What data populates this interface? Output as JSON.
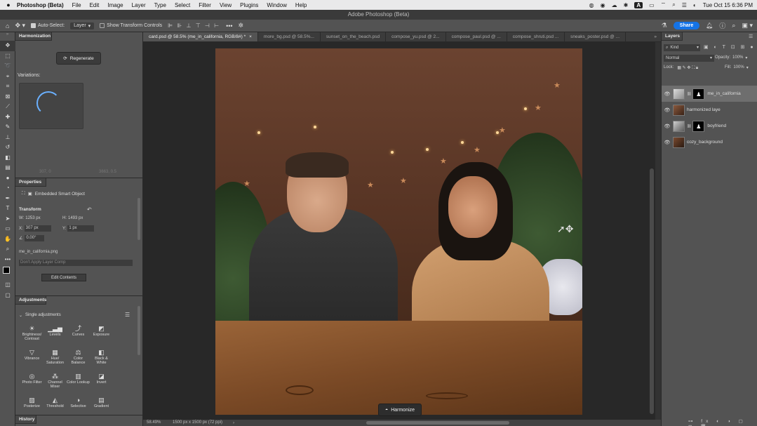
{
  "macbar": {
    "app_name": "Photoshop (Beta)",
    "menus": [
      "File",
      "Edit",
      "Image",
      "Layer",
      "Type",
      "Select",
      "Filter",
      "View",
      "Plugins",
      "Window",
      "Help"
    ],
    "ai_label": "A",
    "datetime": "Tue Oct 15  6:36 PM"
  },
  "window": {
    "title": "Adobe Photoshop (Beta)"
  },
  "options": {
    "auto_select_label": "Auto-Select:",
    "auto_select_target": "Layer",
    "transform_controls_label": "Show Transform Controls",
    "share_label": "Share"
  },
  "tabs": [
    {
      "label": "card.psd @ 58.5% (me_in_california, RGB/8#) *",
      "active": true
    },
    {
      "label": "more_bg.psd @ 58.5%...",
      "active": false
    },
    {
      "label": "sunset_on_the_beach.psd",
      "active": false
    },
    {
      "label": "compose_yu.psd @ 2...",
      "active": false
    },
    {
      "label": "compose_paul.psd @ ...",
      "active": false
    },
    {
      "label": "compose_shruti.psd ...",
      "active": false
    },
    {
      "label": "sneaks_poster.psd @ ...",
      "active": false
    }
  ],
  "harmonization": {
    "title": "Harmonization",
    "regenerate_label": "Regenerate",
    "variations_label": "Variations:",
    "coord_left": "307, 0",
    "coord_right": "3663, 0.5"
  },
  "properties": {
    "title": "Properties",
    "object_type": "Embedded Smart Object",
    "transform_label": "Transform",
    "w_label": "W:",
    "w_value": "1253 px",
    "h_label": "H:",
    "h_value": "1493 px",
    "x_label": "X:",
    "x_value": "307 px",
    "y_label": "Y:",
    "y_value": "1 px",
    "angle_value": "0.00°",
    "filename": "me_in_california.png",
    "layer_comp_placeholder": "Don't Apply Layer Comp",
    "edit_contents_label": "Edit Contents"
  },
  "adjustments": {
    "title": "Adjustments",
    "section_label": "Single adjustments",
    "items": [
      {
        "label": "Brightness/ Contrast",
        "icon": "sun-icon"
      },
      {
        "label": "Levels",
        "icon": "levels-icon"
      },
      {
        "label": "Curves",
        "icon": "curves-icon"
      },
      {
        "label": "Exposure",
        "icon": "exposure-icon"
      },
      {
        "label": "Vibrance",
        "icon": "vibrance-icon"
      },
      {
        "label": "Hue/ Saturation",
        "icon": "hue-icon"
      },
      {
        "label": "Color Balance",
        "icon": "balance-icon"
      },
      {
        "label": "Black & White",
        "icon": "bw-icon"
      },
      {
        "label": "Photo Filter",
        "icon": "photo-filter-icon"
      },
      {
        "label": "Channel Mixer",
        "icon": "mixer-icon"
      },
      {
        "label": "Color Lookup",
        "icon": "lookup-icon"
      },
      {
        "label": "Invert",
        "icon": "invert-icon"
      },
      {
        "label": "Posterize",
        "icon": "posterize-icon"
      },
      {
        "label": "Threshold",
        "icon": "threshold-icon"
      },
      {
        "label": "Selective",
        "icon": "selective-icon"
      },
      {
        "label": "Gradient",
        "icon": "gradient-icon"
      }
    ]
  },
  "history": {
    "title": "History"
  },
  "harmonize_button": {
    "label": "Harmonize"
  },
  "status": {
    "zoom": "58.49%",
    "doc_size": "1500 px x 1500 px (72 ppi)"
  },
  "layers": {
    "title": "Layers",
    "filter": "Kind",
    "blend_mode": "Normal",
    "opacity_label": "Opacity:",
    "opacity_value": "100%",
    "lock_label": "Lock:",
    "fill_label": "Fill:",
    "fill_value": "100%",
    "items": [
      {
        "name": "me_in_california",
        "selected": true,
        "has_mask": true
      },
      {
        "name": "harmonized laye",
        "selected": false,
        "has_mask": false
      },
      {
        "name": "boyfriend",
        "selected": false,
        "has_mask": true
      },
      {
        "name": "cozy_background",
        "selected": false,
        "has_mask": false
      }
    ]
  },
  "colors": {
    "accent": "#1473e6",
    "panel": "#535353",
    "canvas_bg": "#282828"
  }
}
